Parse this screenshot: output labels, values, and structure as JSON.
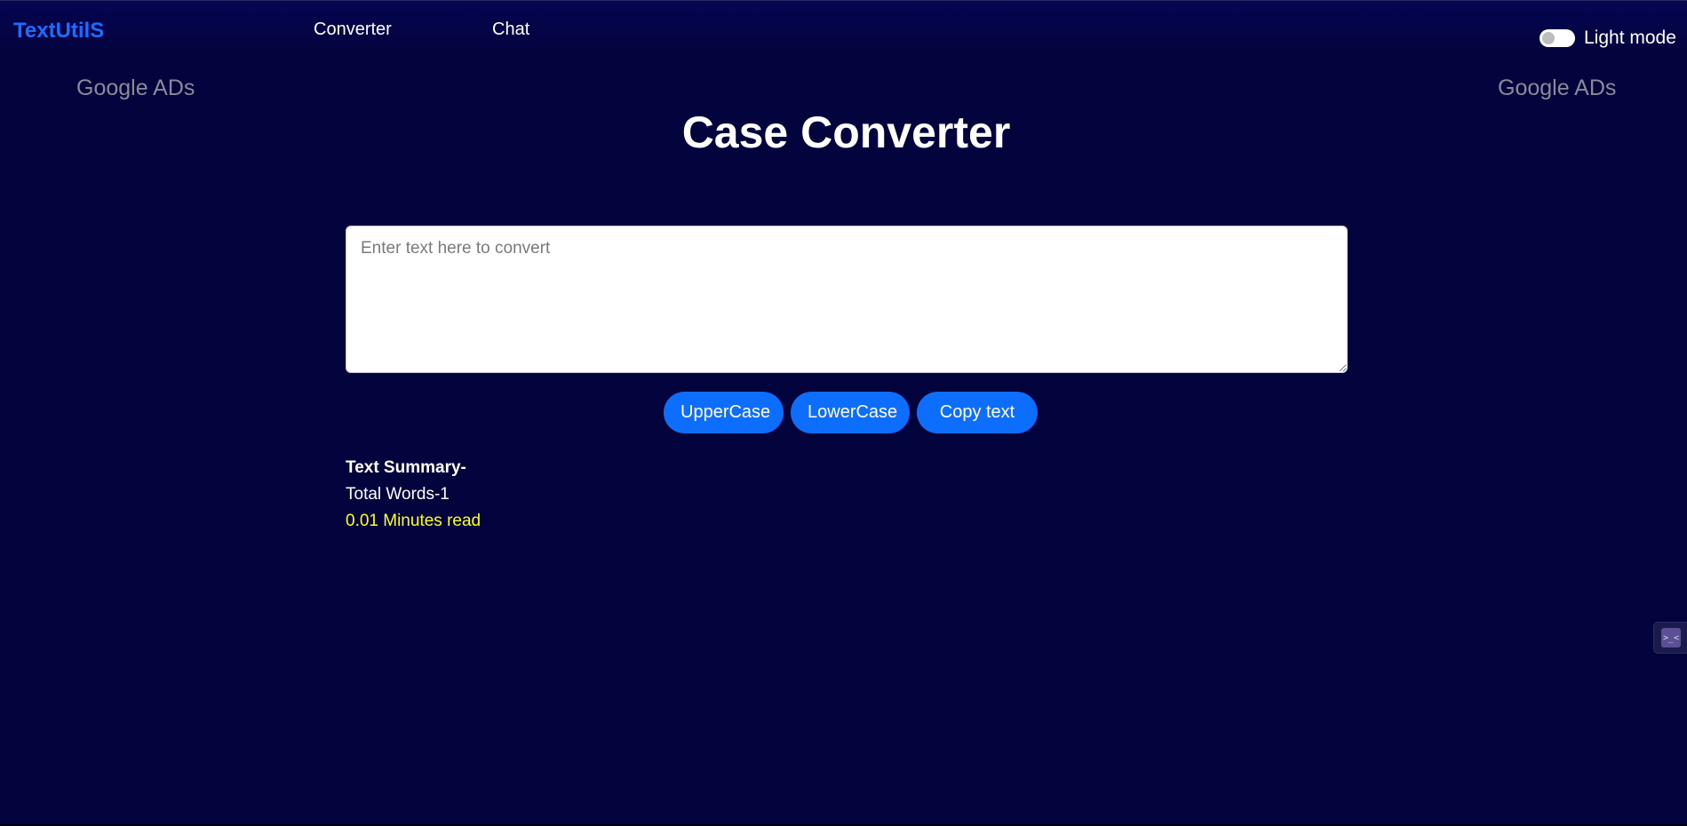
{
  "navbar": {
    "brand": "TextUtilS",
    "links": [
      "Converter",
      "Chat"
    ],
    "mode_label": "Light mode"
  },
  "ads": {
    "left": "Google ADs",
    "right": "Google ADs"
  },
  "main": {
    "title": "Case Converter",
    "textarea_placeholder": "Enter text here to convert",
    "textarea_value": ""
  },
  "buttons": {
    "upper": "UpperCase",
    "lower": "LowerCase",
    "copy": "Copy text"
  },
  "summary": {
    "heading": "Text Summary-",
    "words": "Total Words-1",
    "read_time": "0.01 Minutes read"
  },
  "side_widget": {
    "icon": "chat-widget-icon",
    "glyph": ">_<"
  },
  "colors": {
    "background": "#03033d",
    "brand": "#1a6dff",
    "button": "#0d6efd",
    "read_time": "#ffff1a",
    "ads": "#8a8a99"
  }
}
